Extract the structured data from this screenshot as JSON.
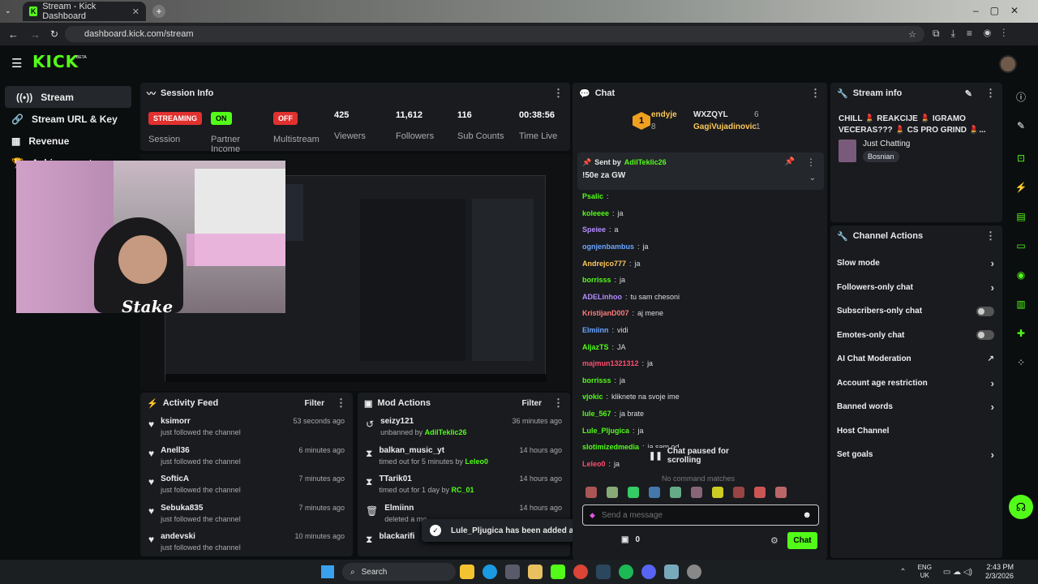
{
  "browser": {
    "tab_title": "Stream - Kick Dashboard",
    "url": "dashboard.kick.com/stream"
  },
  "brand": {
    "logo": "KICK",
    "beta": "BETA",
    "accent": "#53fc18"
  },
  "sidebar": {
    "items": [
      {
        "label": "Stream",
        "icon": "broadcast-icon"
      },
      {
        "label": "Stream URL & Key",
        "icon": "link-icon"
      },
      {
        "label": "Revenue",
        "icon": "chart-icon"
      },
      {
        "label": "Achievements",
        "icon": "trophy-icon"
      }
    ]
  },
  "session": {
    "title": "Session Info",
    "status_badge": "STREAMING",
    "status_label": "Session",
    "partner_badge": "ON",
    "partner_label": "Partner Income",
    "multistream_badge": "OFF",
    "multistream_label": "Multistream",
    "viewers": "425",
    "viewers_label": "Viewers",
    "followers": "11,612",
    "followers_label": "Followers",
    "subs": "116",
    "subs_label": "Sub Counts",
    "time_live": "00:38:56",
    "time_label": "Time Live"
  },
  "webcam": {
    "sponsor": "Stake"
  },
  "activity": {
    "title": "Activity Feed",
    "filter": "Filter",
    "items": [
      {
        "name": "ksimorr",
        "text": "just followed the channel",
        "time": "53 seconds ago"
      },
      {
        "name": "Anell36",
        "text": "just followed the channel",
        "time": "6 minutes ago"
      },
      {
        "name": "SofticA",
        "text": "just followed the channel",
        "time": "7 minutes ago"
      },
      {
        "name": "Sebuka835",
        "text": "just followed the channel",
        "time": "7 minutes ago"
      },
      {
        "name": "andevski",
        "text": "just followed the channel",
        "time": "10 minutes ago"
      }
    ]
  },
  "mod": {
    "title": "Mod Actions",
    "filter": "Filter",
    "items": [
      {
        "name": "seizy121",
        "pre": "unbanned by ",
        "by": "AdilTeklic26",
        "time": "36 minutes ago"
      },
      {
        "name": "balkan_music_yt",
        "pre": "timed out for 5 minutes by ",
        "by": "Leleo0",
        "time": "14 hours ago"
      },
      {
        "name": "TTarik01",
        "pre": "timed out for 1 day by ",
        "by": "RC_01",
        "time": "14 hours ago"
      },
      {
        "name": "Elmiinn",
        "pre": "deleted a me",
        "by": "",
        "time": "14 hours ago"
      },
      {
        "name": "blackarifi",
        "pre": "",
        "by": "",
        "time": ""
      }
    ]
  },
  "toast": {
    "text": "Lule_Pljugica has been added as og!"
  },
  "chat": {
    "title": "Chat",
    "leaders": [
      {
        "rank": "1",
        "name": "endyje",
        "count": "8"
      },
      {
        "name": "WXZQYL",
        "count": "6"
      },
      {
        "name": "GagiVujadinovic",
        "count": "1"
      }
    ],
    "pinned": {
      "sent_by": "Sent by",
      "user": "AdilTeklic26",
      "text": "!50e za GW"
    },
    "lines": [
      {
        "user": "Psalic",
        "color": "#53fc18",
        "msg": ""
      },
      {
        "user": "koleeee",
        "color": "#53fc18",
        "msg": "ja"
      },
      {
        "user": "Speiee",
        "color": "#b48cff",
        "msg": "a"
      },
      {
        "user": "ognjenbambus",
        "color": "#6aa5ff",
        "msg": "ja"
      },
      {
        "user": "Andrejco777",
        "color": "#ffc857",
        "msg": "ja"
      },
      {
        "user": "borrisss",
        "color": "#53fc18",
        "msg": "ja"
      },
      {
        "user": "ADELinhoo",
        "color": "#b48cff",
        "msg": "tu sam chesoni"
      },
      {
        "user": "KristijanD007",
        "color": "#ff7b7b",
        "msg": "aj mene"
      },
      {
        "user": "Elmiinn",
        "color": "#6aa5ff",
        "msg": "vidi"
      },
      {
        "user": "AljazTS",
        "color": "#53fc18",
        "msg": "JA"
      },
      {
        "user": "majmun1321312",
        "color": "#ff4d6d",
        "msg": "ja"
      },
      {
        "user": "borrisss",
        "color": "#53fc18",
        "msg": "ja"
      },
      {
        "user": "vjokic",
        "color": "#53fc18",
        "msg": "kliknete na svoje ime"
      },
      {
        "user": "lule_567",
        "color": "#53fc18",
        "msg": "ja brate"
      },
      {
        "user": "Lule_Pljugica",
        "color": "#53fc18",
        "msg": "ja"
      },
      {
        "user": "slotimizedmedia",
        "color": "#53fc18",
        "msg": "ja sam od ..."
      },
      {
        "user": "Leleo0",
        "color": "#ff4d6d",
        "msg": "ja"
      }
    ],
    "paused": "Chat paused for scrolling",
    "no_match": "No command matches",
    "input_placeholder": "Send a message",
    "points": "0",
    "send": "Chat"
  },
  "stream_info": {
    "title": "Stream info",
    "stream_title": "CHILL 💄 REAKCIJE 💄 IGRAMO VECERAS??? 💄 CS PRO GRIND 💄...",
    "category": "Just Chatting",
    "language": "Bosnian"
  },
  "channel_actions": {
    "title": "Channel Actions",
    "items": [
      {
        "label": "Slow mode",
        "ctrl": "chevron"
      },
      {
        "label": "Followers-only chat",
        "ctrl": "chevron"
      },
      {
        "label": "Subscribers-only chat",
        "ctrl": "toggle"
      },
      {
        "label": "Emotes-only chat",
        "ctrl": "toggle"
      },
      {
        "label": "AI Chat Moderation",
        "ctrl": "external"
      },
      {
        "label": "Account age restriction",
        "ctrl": "chevron"
      },
      {
        "label": "Banned words",
        "ctrl": "chevron"
      },
      {
        "label": "Host Channel",
        "ctrl": "none"
      },
      {
        "label": "Set goals",
        "ctrl": "chevron"
      }
    ]
  },
  "taskbar": {
    "search": "Search",
    "lang": "ENG",
    "region": "UK",
    "time": "2:43 PM",
    "date": "2/3/2026"
  }
}
